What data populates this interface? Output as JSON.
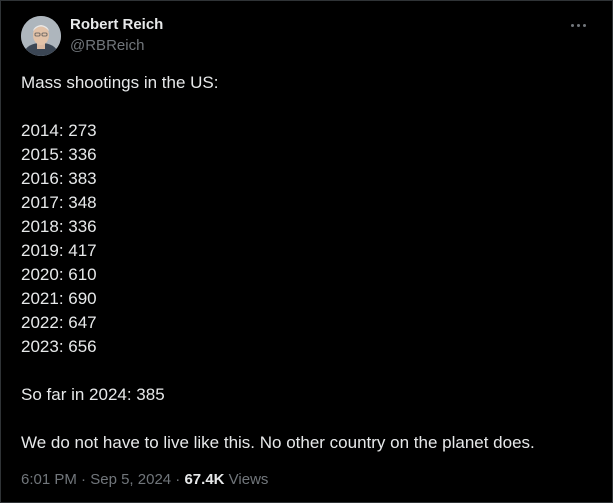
{
  "author": {
    "name": "Robert Reich",
    "handle": "@RBReich"
  },
  "tweet": {
    "intro": "Mass shootings in the US:",
    "stats": [
      "2014: 273",
      "2015: 336",
      "2016: 383",
      "2017: 348",
      "2018: 336",
      "2019: 417",
      "2020: 610",
      "2021: 690",
      "2022: 647",
      "2023: 656"
    ],
    "so_far": "So far in 2024: 385",
    "closing": "We do not have to live like this. No other country on the planet does."
  },
  "meta": {
    "time": "6:01 PM",
    "separator": "·",
    "date": "Sep 5, 2024",
    "views_count": "67.4K",
    "views_label": "Views"
  },
  "icons": {
    "more": "more-horizontal-icon"
  },
  "colors": {
    "background": "#000000",
    "text": "#e7e9ea",
    "secondary_text": "#71767b",
    "border": "#2f3336"
  }
}
